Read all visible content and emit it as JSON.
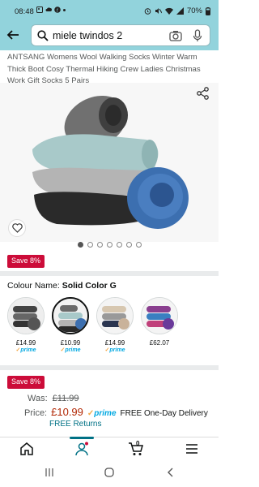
{
  "status_bar": {
    "time": "08:48",
    "battery": "70%"
  },
  "search": {
    "query": "miele twindos 2"
  },
  "product": {
    "title": "ANTSANG Womens Wool Walking Socks Winter Warm Thick Boot Cosy Thermal Hiking Crew Ladies Christmas Work Gift Socks 5 Pairs",
    "image_dots": {
      "count": 7,
      "active": 0
    },
    "badge_top": "Save 8%",
    "colour_label": "Colour Name:",
    "colour_value": "Solid Color G",
    "swatches": [
      {
        "price": "£14.99",
        "prime": "prime",
        "selected": false
      },
      {
        "price": "£10.99",
        "prime": "prime",
        "selected": true
      },
      {
        "price": "£14.99",
        "prime": "prime",
        "selected": false
      },
      {
        "price": "£62.07",
        "prime": "",
        "selected": false
      }
    ],
    "badge_bottom": "Save 8%",
    "was_label": "Was:",
    "was_price": "£11.99",
    "price_label": "Price:",
    "price": "£10.99",
    "prime_label": "prime",
    "delivery": "FREE One-Day Delivery",
    "returns": "FREE Returns"
  },
  "bottom_nav": {
    "cart_count": "0",
    "items": [
      "home-icon",
      "account-icon",
      "cart-icon",
      "menu-icon"
    ]
  },
  "colors": {
    "header_bg": "#92d3dc",
    "badge": "#cc0c39",
    "price": "#b12704",
    "link": "#007185",
    "prime": "#00a8e1"
  }
}
